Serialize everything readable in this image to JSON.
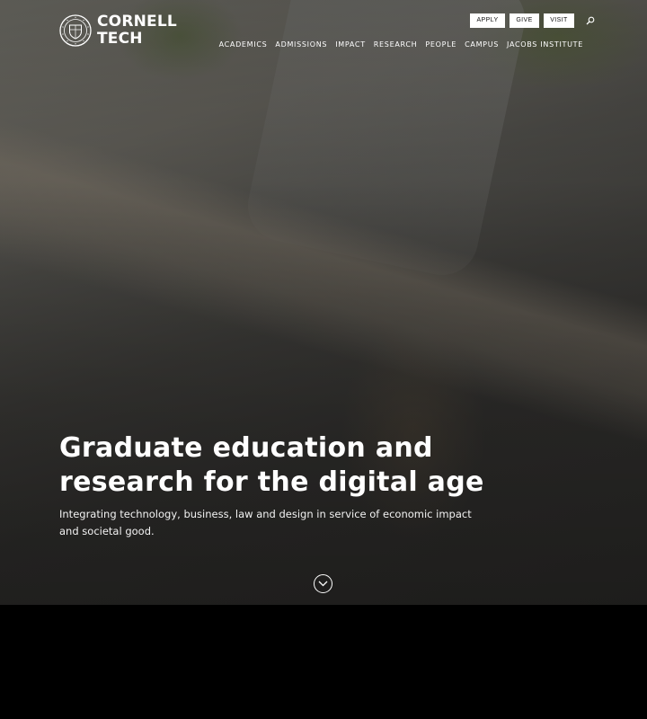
{
  "logo": {
    "line1": "CORNELL",
    "line2": "TECH",
    "seal_icon": "cornell-seal-icon"
  },
  "utility_nav": {
    "apply": "APPLY",
    "give": "GIVE",
    "visit": "VISIT",
    "search_icon": "search-icon"
  },
  "main_nav": [
    {
      "label": "ACADEMICS"
    },
    {
      "label": "ADMISSIONS"
    },
    {
      "label": "IMPACT"
    },
    {
      "label": "RESEARCH"
    },
    {
      "label": "PEOPLE"
    },
    {
      "label": "CAMPUS"
    },
    {
      "label": "JACOBS INSTITUTE"
    }
  ],
  "hero": {
    "headline": "Graduate education and research for the digital age",
    "subheadline": "Integrating technology, business, law and design in service of economic impact and societal good.",
    "scroll_icon": "chevron-down-icon"
  },
  "colors": {
    "text": "#ffffff",
    "button_bg": "#ffffff",
    "button_text": "#111111",
    "page_bg": "#000000"
  }
}
